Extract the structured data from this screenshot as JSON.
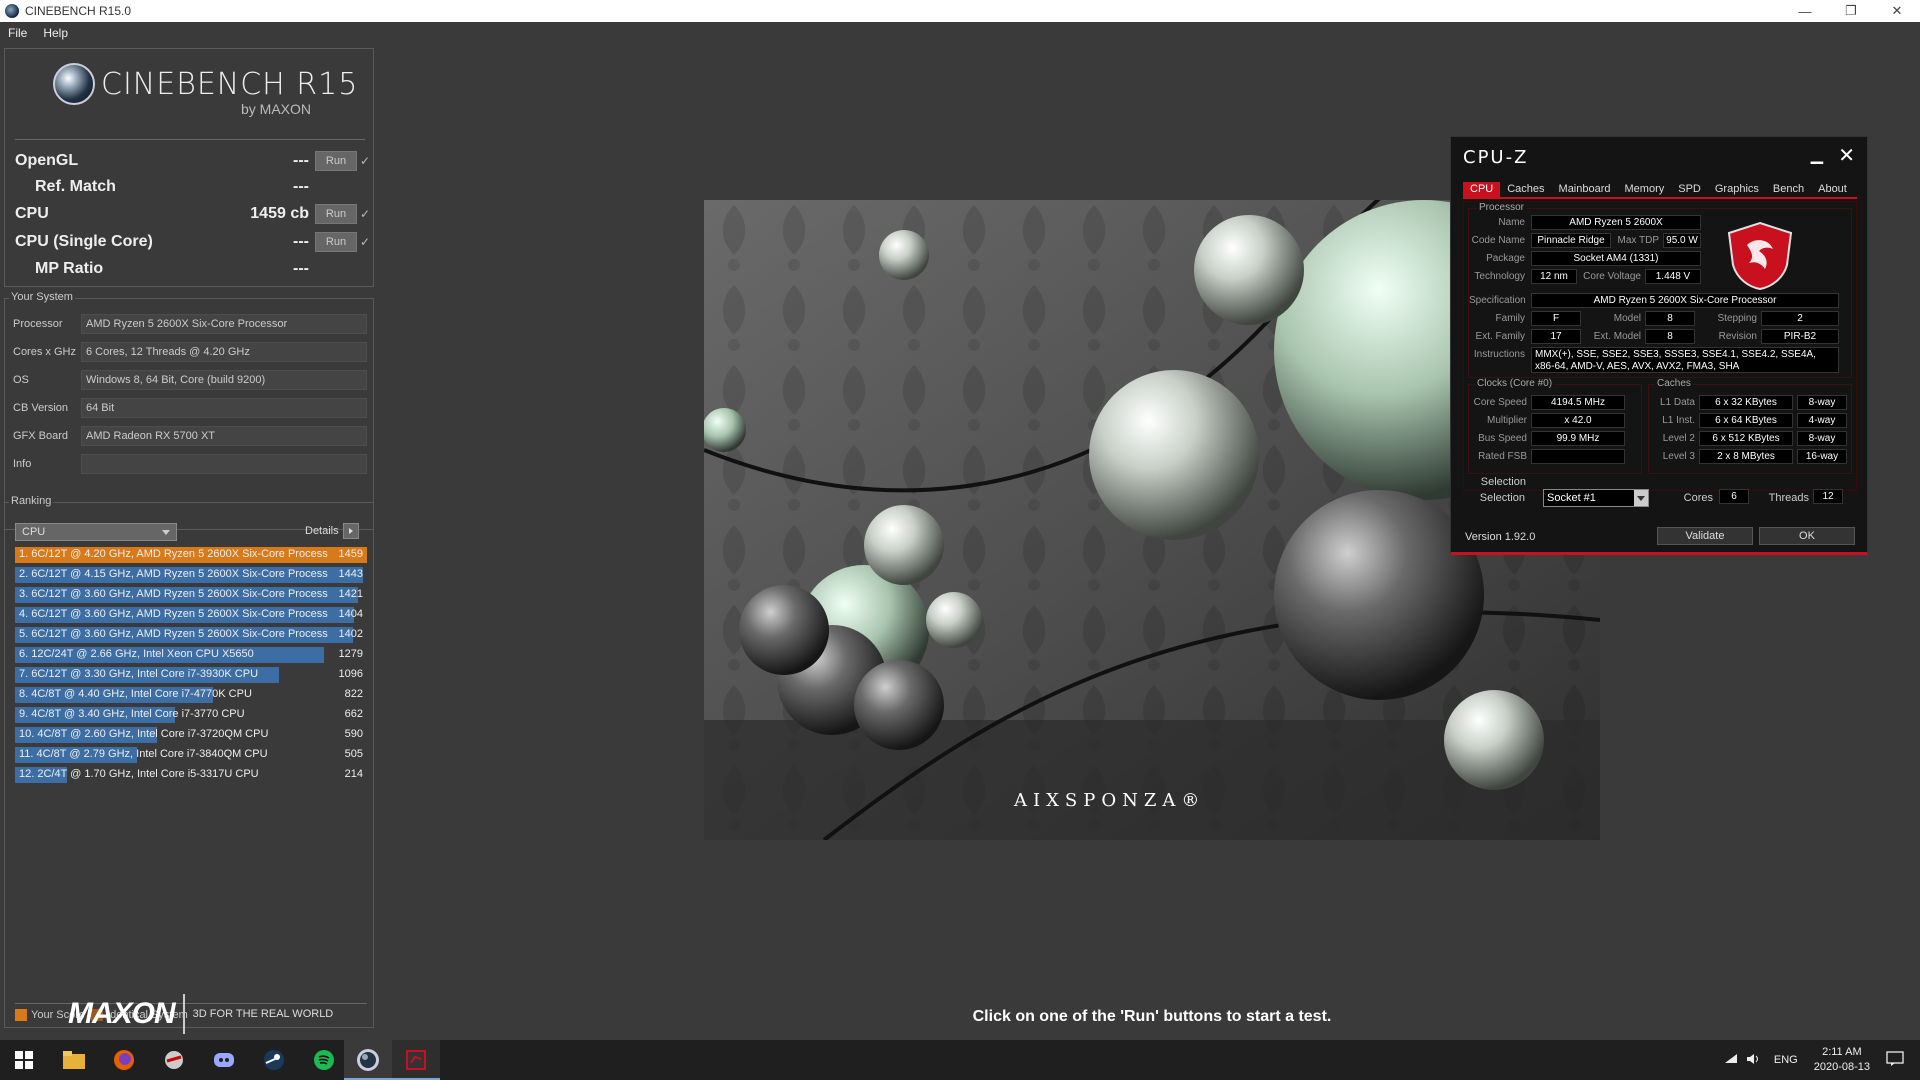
{
  "window": {
    "title": "CINEBENCH R15.0",
    "minimize": "—",
    "restore": "❐",
    "close": "✕"
  },
  "menu": [
    "File",
    "Help"
  ],
  "logo": {
    "name": "CINEBENCH R15",
    "by": "by MAXON"
  },
  "benchmarks": [
    {
      "label": "OpenGL",
      "value": "---",
      "run": "Run",
      "check": "✓",
      "indent": false
    },
    {
      "label": "Ref. Match",
      "value": "---",
      "indent": true
    },
    {
      "label": "CPU",
      "value": "1459 cb",
      "run": "Run",
      "check": "✓",
      "indent": false
    },
    {
      "label": "CPU (Single Core)",
      "value": "---",
      "run": "Run",
      "check": "✓",
      "indent": false
    },
    {
      "label": "MP Ratio",
      "value": "---",
      "indent": true
    }
  ],
  "your_system": {
    "title": "Your System",
    "rows": [
      {
        "k": "Processor",
        "v": "AMD Ryzen 5 2600X Six-Core Processor"
      },
      {
        "k": "Cores x GHz",
        "v": "6 Cores, 12 Threads @ 4.20 GHz"
      },
      {
        "k": "OS",
        "v": "Windows 8, 64 Bit, Core (build 9200)"
      },
      {
        "k": "CB Version",
        "v": "64 Bit"
      },
      {
        "k": "GFX Board",
        "v": "AMD Radeon RX 5700 XT"
      },
      {
        "k": "Info",
        "v": ""
      }
    ]
  },
  "ranking": {
    "title": "Ranking",
    "select": "CPU",
    "details": "Details",
    "max_score": 1459,
    "items": [
      {
        "text": "1. 6C/12T @ 4.20 GHz, AMD Ryzen 5 2600X Six-Core Process",
        "score": 1459,
        "mine": true
      },
      {
        "text": "2. 6C/12T @ 4.15 GHz, AMD Ryzen 5 2600X Six-Core Process",
        "score": 1443,
        "mine": false
      },
      {
        "text": "3. 6C/12T @ 3.60 GHz, AMD Ryzen 5 2600X Six-Core Process",
        "score": 1421,
        "mine": false
      },
      {
        "text": "4. 6C/12T @ 3.60 GHz, AMD Ryzen 5 2600X Six-Core Process",
        "score": 1404,
        "mine": false
      },
      {
        "text": "5. 6C/12T @ 3.60 GHz, AMD Ryzen 5 2600X Six-Core Process",
        "score": 1402,
        "mine": false
      },
      {
        "text": "6. 12C/24T @ 2.66 GHz, Intel Xeon CPU X5650",
        "score": 1279,
        "mine": false
      },
      {
        "text": "7. 6C/12T @ 3.30 GHz,  Intel Core i7-3930K CPU",
        "score": 1096,
        "mine": false
      },
      {
        "text": "8. 4C/8T @ 4.40 GHz, Intel Core i7-4770K CPU",
        "score": 822,
        "mine": false
      },
      {
        "text": "9. 4C/8T @ 3.40 GHz,  Intel Core i7-3770 CPU",
        "score": 662,
        "mine": false
      },
      {
        "text": "10. 4C/8T @ 2.60 GHz, Intel Core i7-3720QM CPU",
        "score": 590,
        "mine": false
      },
      {
        "text": "11. 4C/8T @ 2.79 GHz, Intel Core i7-3840QM CPU",
        "score": 505,
        "mine": false
      },
      {
        "text": "12. 2C/4T @ 1.70 GHz,  Intel Core i5-3317U CPU",
        "score": 214,
        "mine": false
      }
    ],
    "legend": [
      {
        "label": "Your Score",
        "color": "#d97a1a"
      },
      {
        "label": "Identical System",
        "color": "#a0581a"
      }
    ]
  },
  "footer": {
    "brand": "MAXON",
    "tagline": "3D FOR THE REAL WORLD",
    "status": "Click on one of the 'Run' buttons to start a test."
  },
  "render_caption": "AIXSPONZA®",
  "cpuz": {
    "title": "CPU-Z",
    "tabs": [
      "CPU",
      "Caches",
      "Mainboard",
      "Memory",
      "SPD",
      "Graphics",
      "Bench",
      "About"
    ],
    "active_tab": "CPU",
    "processor": {
      "title": "Processor",
      "name_k": "Name",
      "name": "AMD Ryzen 5 2600X",
      "code_k": "Code Name",
      "code": "Pinnacle Ridge",
      "tdp_k": "Max TDP",
      "tdp": "95.0 W",
      "package_k": "Package",
      "package": "Socket AM4 (1331)",
      "tech_k": "Technology",
      "tech": "12 nm",
      "volt_k": "Core Voltage",
      "volt": "1.448 V",
      "spec_k": "Specification",
      "spec": "AMD Ryzen 5 2600X Six-Core Processor",
      "family_k": "Family",
      "family": "F",
      "model_k": "Model",
      "model": "8",
      "stepping_k": "Stepping",
      "stepping": "2",
      "extfam_k": "Ext. Family",
      "extfam": "17",
      "extmod_k": "Ext. Model",
      "extmod": "8",
      "rev_k": "Revision",
      "rev": "PIR-B2",
      "instr_k": "Instructions",
      "instr": "MMX(+), SSE, SSE2, SSE3, SSSE3, SSE4.1, SSE4.2, SSE4A, x86-64, AMD-V, AES, AVX, AVX2, FMA3, SHA"
    },
    "clocks": {
      "title": "Clocks (Core #0)",
      "speed_k": "Core Speed",
      "speed": "4194.5 MHz",
      "mult_k": "Multiplier",
      "mult": "x 42.0",
      "bus_k": "Bus Speed",
      "bus": "99.9 MHz",
      "fsb_k": "Rated FSB",
      "fsb": ""
    },
    "caches": {
      "title": "Caches",
      "rows": [
        {
          "k": "L1 Data",
          "v": "6 x 32 KBytes",
          "w": "8-way"
        },
        {
          "k": "L1 Inst.",
          "v": "6 x 64 KBytes",
          "w": "4-way"
        },
        {
          "k": "Level 2",
          "v": "6 x 512 KBytes",
          "w": "8-way"
        },
        {
          "k": "Level 3",
          "v": "2 x 8 MBytes",
          "w": "16-way"
        }
      ]
    },
    "selection": {
      "k": "Selection",
      "v": "Socket #1",
      "cores_k": "Cores",
      "cores": "6",
      "threads_k": "Threads",
      "threads": "12"
    },
    "version": "Version 1.92.0",
    "validate": "Validate",
    "ok": "OK"
  },
  "taskbar": {
    "lang": "ENG",
    "time": "2:11 AM",
    "date": "2020-08-13"
  }
}
